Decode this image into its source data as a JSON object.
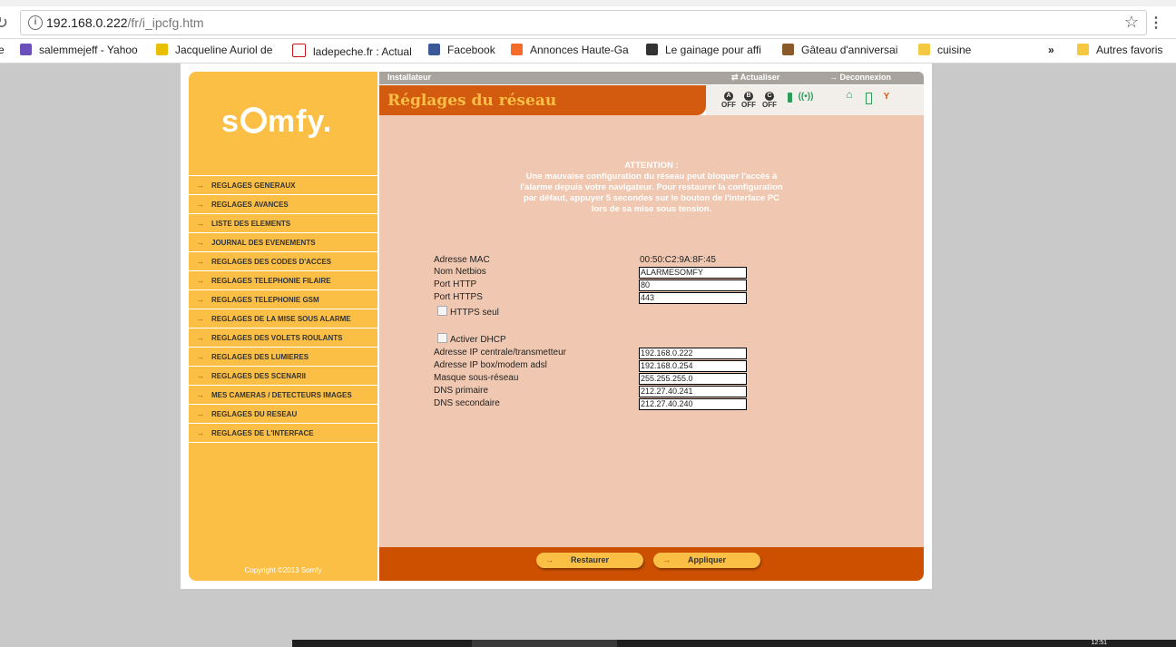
{
  "browser": {
    "url_host": "192.168.0.222",
    "url_path": "/fr/i_ipcfg.htm",
    "bookmarks": [
      {
        "label": "salemmejeff - Yahoo",
        "icon": "yahoo-mail-icon",
        "color": "#6b4fbb"
      },
      {
        "label": "Jacqueline Auriol de",
        "icon": "yellow-bird-icon",
        "color": "#e8c000"
      },
      {
        "label": "ladepeche.fr : Actual",
        "icon": "ladepeche-icon",
        "color": "#c4161c"
      },
      {
        "label": "Facebook",
        "icon": "facebook-icon",
        "color": "#3b5998"
      },
      {
        "label": "Annonces Haute-Ga",
        "icon": "leboncoin-icon",
        "color": "#f56b2a"
      },
      {
        "label": "Le gainage pour affi",
        "icon": "fitness-icon",
        "color": "#333333"
      },
      {
        "label": "Gâteau d'anniversai",
        "icon": "cake-icon",
        "color": "#8b5a2b"
      },
      {
        "label": "cuisine",
        "icon": "folder-icon",
        "color": "#f5c842"
      }
    ],
    "overflow": "»",
    "other_bookmarks": "Autres favoris"
  },
  "header": {
    "user": "Installateur",
    "refresh": "Actualiser",
    "logout": "Deconnexion",
    "page_title": "Réglages du réseau",
    "status": [
      {
        "letter": "A",
        "state": "OFF"
      },
      {
        "letter": "B",
        "state": "OFF"
      },
      {
        "letter": "C",
        "state": "OFF"
      }
    ]
  },
  "sidebar": {
    "logo": "somfy",
    "items": [
      "REGLAGES GENERAUX",
      "REGLAGES AVANCES",
      "LISTE DES ELEMENTS",
      "JOURNAL DES EVENEMENTS",
      "REGLAGES DES CODES D'ACCES",
      "REGLAGES TELEPHONIE FILAIRE",
      "REGLAGES TELEPHONIE GSM",
      "REGLAGES DE LA MISE SOUS ALARME",
      "REGLAGES DES VOLETS ROULANTS",
      "REGLAGES DES LUMIERES",
      "REGLAGES DES SCENARII",
      "MES CAMERAS / DETECTEURS IMAGES",
      "REGLAGES DU RESEAU",
      "REGLAGES DE L'INTERFACE"
    ],
    "copyright": "Copyright ©2013 Somfy"
  },
  "content": {
    "attention_title": "ATTENTION :",
    "attention_text": "Une mauvaise configuration du réseau peut bloquer l'accès à l'alarme depuis votre navigateur. Pour restaurer la configuration par défaut, appuyer 5 secondes sur le bouton de l'interface PC lors de sa mise sous tension.",
    "mac_label": "Adresse MAC",
    "mac_value": "00:50:C2:9A:8F:45",
    "netbios_label": "Nom Netbios",
    "netbios_value": "ALARMESOMFY",
    "http_label": "Port HTTP",
    "http_value": "80",
    "https_label": "Port HTTPS",
    "https_value": "443",
    "https_only_label": "HTTPS seul",
    "dhcp_label": "Activer DHCP",
    "ip_label": "Adresse IP centrale/transmetteur",
    "ip_value": "192.168.0.222",
    "gateway_label": "Adresse IP box/modem adsl",
    "gateway_value": "192.168.0.254",
    "mask_label": "Masque sous-réseau",
    "mask_value": "255.255.255.0",
    "dns1_label": "DNS primaire",
    "dns1_value": "212.27.40.241",
    "dns2_label": "DNS secondaire",
    "dns2_value": "212.27.40.240"
  },
  "footer": {
    "restore": "Restaurer",
    "apply": "Appliquer"
  },
  "taskbar": {
    "clock": "12:51"
  },
  "colors": {
    "sidebar": "#fbbf45",
    "accent": "#d25b0f",
    "content_bg": "#f0c8b1"
  }
}
